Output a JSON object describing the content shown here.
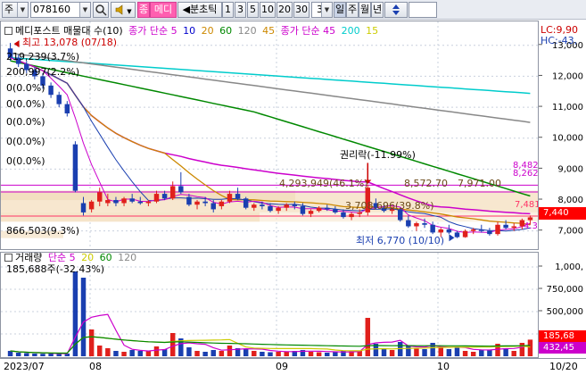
{
  "toolbar": {
    "market_label": "주",
    "code_value": "078160",
    "sound_icon": "speaker-icon",
    "pink_label_1": "종",
    "pink_label_2": "메디",
    "period_prefix": "◀분초틱",
    "periods": [
      "1",
      "3",
      "5",
      "10",
      "20",
      "30"
    ],
    "period_selected": "3",
    "day_btn": "일",
    "week_btn": "주",
    "month_btn": "월",
    "year_btn": "년",
    "updown_icon": "up-down-arrows-icon"
  },
  "price_pane": {
    "legend": [
      {
        "text": "메디포스트 매물대 수(10)",
        "color": "#000000"
      },
      {
        "text": "종가 단순 5",
        "color": "#cc00cc"
      },
      {
        "text": "10",
        "color": "#0000cc"
      },
      {
        "text": "20",
        "color": "#cc8800"
      },
      {
        "text": "60",
        "color": "#008800"
      },
      {
        "text": "120",
        "color": "#888888"
      },
      {
        "text": "45",
        "color": "#cc8800"
      },
      {
        "text": "종가 단순 45",
        "color": "#cc00cc"
      },
      {
        "text": "200",
        "color": "#00cccc"
      },
      {
        "text": "15",
        "color": "#cccc00"
      }
    ],
    "high_label": "최고 13,078 (07/18)",
    "top_right_1": "LC:9,90",
    "top_right_2": "HC:-43,",
    "left_labels": [
      "219,239(3.7%)",
      "200,997(2.2%)",
      "0(0.0%)",
      "0(0.0%)",
      "0(0.0%)",
      "0(0.0%)",
      "0(0.0%)"
    ],
    "bottom_left_label": "866,503(9.3%)",
    "rights_label": "권리락(-11.99%)",
    "range_label_1": "4,293,949(46.1%)",
    "range_label_2": "8,572.70",
    "range_label_3": "7,971.00",
    "range_label_4": "3,708,696(39.8%)",
    "low_label": "최저 6,770 (10/10)",
    "line_label_red": "7,481",
    "line_label_pink1": "8,482",
    "line_label_pink2": "8,262",
    "pct_label": "4.35%",
    "price_box": "7,440",
    "price_box_color": "#ff0000"
  },
  "price_axis": [
    "13,000",
    "12,000",
    "11,000",
    "10,000",
    "9,000",
    "8,000",
    "7,000"
  ],
  "vol_pane": {
    "legend_volume": "거래량",
    "legend_ma": "단순",
    "ma_periods": [
      "5",
      "20",
      "60",
      "120"
    ],
    "ma_colors": [
      "#cc00cc",
      "#cccc00",
      "#008800",
      "#888888"
    ],
    "volume_value": "185,688주(-32.43%)",
    "vol_box_1": "185,68",
    "vol_box_2": "432,45"
  },
  "vol_axis": [
    "1,000,",
    "750,000",
    "500,000",
    "250,000"
  ],
  "x_axis": [
    "2023/07",
    "08",
    "09",
    "10",
    "10/20"
  ],
  "chart_data": {
    "type": "candlestick",
    "ylim": [
      6500,
      13600
    ],
    "candles_ohlc": [
      [
        12900,
        13078,
        12500,
        12600
      ],
      [
        12600,
        12700,
        12300,
        12400
      ],
      [
        12400,
        12500,
        12100,
        12200
      ],
      [
        12200,
        12300,
        11900,
        12000
      ],
      [
        12000,
        12100,
        11600,
        11700
      ],
      [
        11700,
        11800,
        11300,
        11400
      ],
      [
        11400,
        11500,
        11000,
        11100
      ],
      [
        11100,
        11200,
        10700,
        10800
      ],
      [
        9800,
        9900,
        8250,
        8300
      ],
      [
        7900,
        8100,
        7500,
        7600
      ],
      [
        7700,
        8000,
        7600,
        7950
      ],
      [
        7950,
        8400,
        7800,
        8250
      ],
      [
        7900,
        8200,
        7800,
        8000
      ],
      [
        8000,
        8100,
        7800,
        7900
      ],
      [
        7900,
        8100,
        7800,
        8050
      ],
      [
        8050,
        8200,
        7900,
        7950
      ],
      [
        7950,
        8100,
        7850,
        7900
      ],
      [
        7900,
        8000,
        7800,
        7950
      ],
      [
        7950,
        8300,
        7900,
        8200
      ],
      [
        8200,
        8300,
        8000,
        8050
      ],
      [
        8050,
        8600,
        8000,
        8450
      ],
      [
        8450,
        8900,
        8200,
        8250
      ],
      [
        8100,
        8200,
        7800,
        7850
      ],
      [
        7850,
        8000,
        7700,
        7950
      ],
      [
        7950,
        8100,
        7800,
        7900
      ],
      [
        7900,
        8000,
        7600,
        7700
      ],
      [
        7800,
        8000,
        7700,
        7950
      ],
      [
        7950,
        8300,
        7900,
        8200
      ],
      [
        8200,
        8400,
        8000,
        8050
      ],
      [
        8050,
        8100,
        7700,
        7750
      ],
      [
        7750,
        7900,
        7650,
        7850
      ],
      [
        7850,
        7950,
        7700,
        7800
      ],
      [
        7800,
        7900,
        7600,
        7650
      ],
      [
        7650,
        7800,
        7550,
        7750
      ],
      [
        7750,
        7900,
        7650,
        7850
      ],
      [
        7850,
        7950,
        7700,
        7800
      ],
      [
        7800,
        7900,
        7500,
        7550
      ],
      [
        7550,
        7700,
        7450,
        7650
      ],
      [
        7650,
        7800,
        7600,
        7750
      ],
      [
        7750,
        7850,
        7650,
        7700
      ],
      [
        7700,
        7800,
        7550,
        7600
      ],
      [
        7600,
        7700,
        7400,
        7450
      ],
      [
        7450,
        7600,
        7350,
        7550
      ],
      [
        7550,
        7700,
        7450,
        7600
      ],
      [
        7600,
        8500,
        7500,
        8400
      ],
      [
        7900,
        8050,
        7700,
        7750
      ],
      [
        7750,
        7900,
        7600,
        7650
      ],
      [
        7650,
        7800,
        7550,
        7700
      ],
      [
        7700,
        7750,
        7300,
        7350
      ],
      [
        7350,
        7500,
        7100,
        7150
      ],
      [
        7150,
        7300,
        7000,
        7250
      ],
      [
        7250,
        7400,
        7100,
        7200
      ],
      [
        7200,
        7300,
        6900,
        6950
      ],
      [
        6950,
        7100,
        6800,
        7050
      ],
      [
        7050,
        7200,
        6900,
        6950
      ],
      [
        6950,
        7000,
        6770,
        6800
      ],
      [
        6800,
        7050,
        6780,
        7000
      ],
      [
        7000,
        7100,
        6900,
        7050
      ],
      [
        7050,
        7200,
        6950,
        7000
      ],
      [
        7000,
        7100,
        6850,
        6900
      ],
      [
        6900,
        7300,
        6850,
        7200
      ],
      [
        7200,
        7350,
        7050,
        7100
      ],
      [
        7100,
        7250,
        7000,
        7150
      ],
      [
        7150,
        7400,
        7050,
        7350
      ],
      [
        7350,
        7500,
        7200,
        7440
      ]
    ],
    "volumes_k": [
      60,
      40,
      35,
      30,
      28,
      30,
      25,
      30,
      950,
      880,
      300,
      120,
      90,
      60,
      50,
      70,
      60,
      55,
      110,
      80,
      260,
      200,
      100,
      60,
      50,
      70,
      60,
      120,
      90,
      80,
      60,
      50,
      45,
      50,
      55,
      60,
      70,
      50,
      45,
      40,
      45,
      60,
      55,
      65,
      430,
      140,
      90,
      70,
      160,
      120,
      90,
      80,
      150,
      100,
      80,
      95,
      60,
      50,
      75,
      70,
      140,
      90,
      60,
      150,
      186
    ]
  }
}
